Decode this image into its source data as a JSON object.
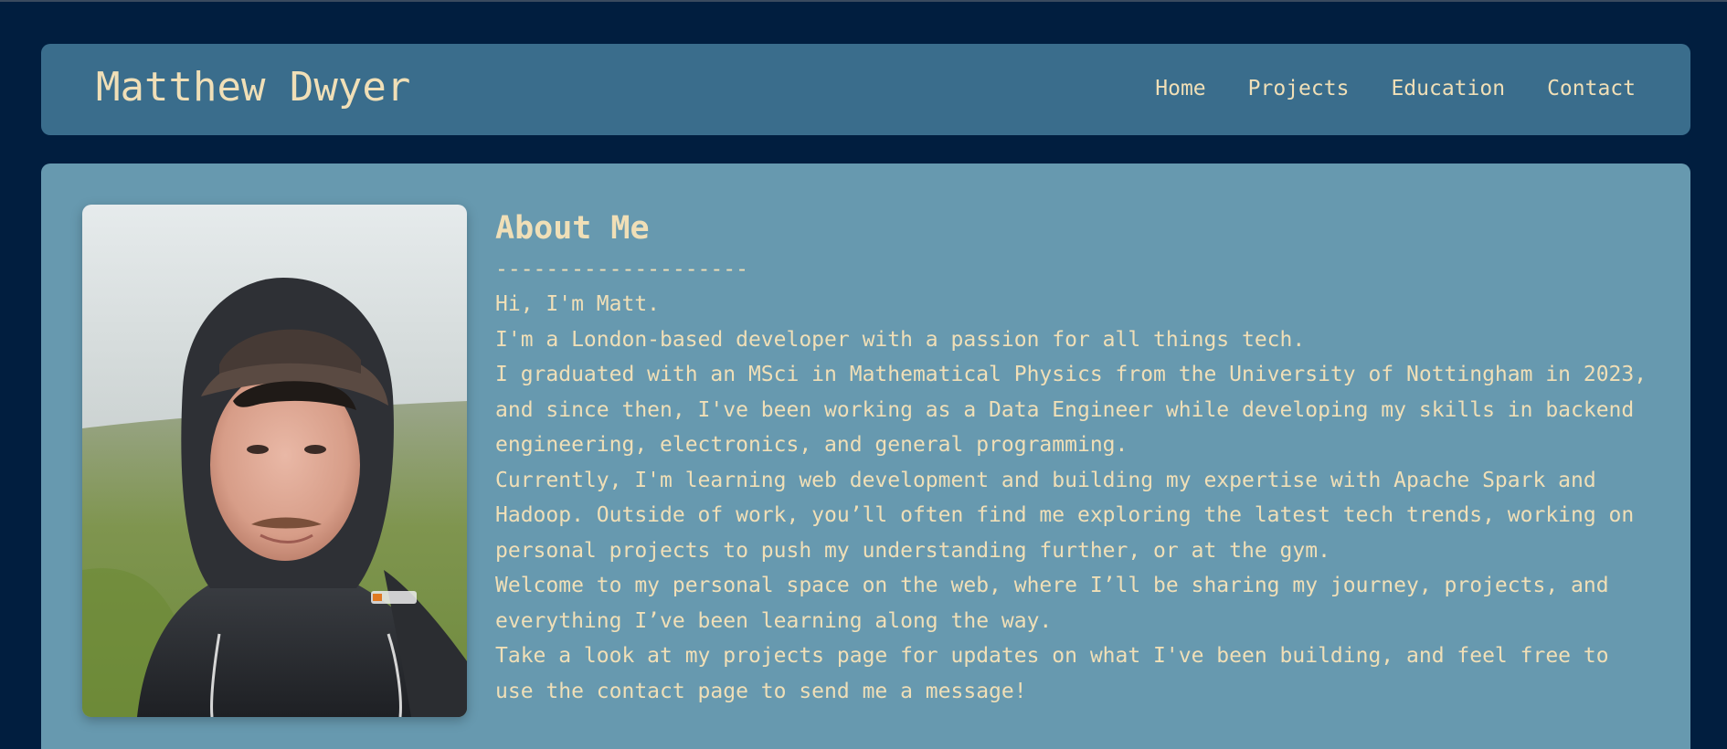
{
  "header": {
    "title": "Matthew Dwyer",
    "nav": [
      "Home",
      "Projects",
      "Education",
      "Contact"
    ]
  },
  "about": {
    "heading": "About Me",
    "divider": "--------------------",
    "paragraphs": [
      "Hi, I'm Matt.",
      "I'm a London-based developer with a passion for all things tech.",
      "I graduated with an MSci in Mathematical Physics from the University of Nottingham in 2023, and since then, I've been working as a Data Engineer while developing my skills in backend engineering, electronics, and general programming.",
      "Currently, I'm learning web development and building my expertise with Apache Spark and Hadoop. Outside of work, you’ll often find me exploring the latest tech trends, working on personal projects to push my understanding further, or at the gym.",
      "Welcome to my personal space on the web, where I’ll be sharing my journey, projects, and everything I’ve been learning along the way.",
      "Take a look at my projects page for updates on what I've been building, and feel free to use the contact page to send me a message!"
    ],
    "photo_icon": "profile-photo"
  },
  "colors": {
    "page_background": "#011e3f",
    "header_background": "#3a6d8c",
    "panel_background": "#6799af",
    "text": "#f0dfb7"
  }
}
